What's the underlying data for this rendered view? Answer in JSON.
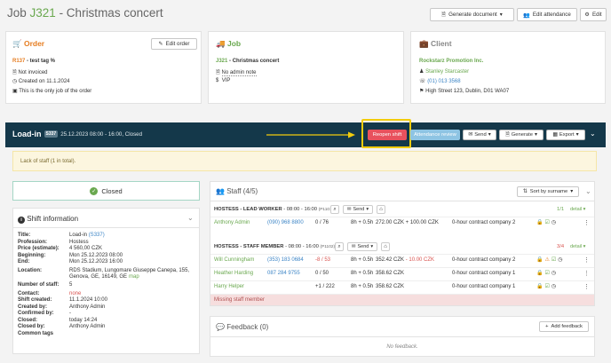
{
  "header": {
    "title_prefix": "Job ",
    "job_number": "J321",
    "title_suffix": " - Christmas concert",
    "generate_label": "Generate document",
    "edit_attendance_label": "Edit attendance",
    "edit_label": "Edit"
  },
  "order": {
    "heading": "Order",
    "edit_label": "Edit order",
    "code": "R137",
    "name": " - test tag %",
    "invoiced": "Not invoiced",
    "created": "Created on 11.1.2024",
    "only_job": "This is the only job of the order"
  },
  "job": {
    "heading": "Job",
    "code": "J321",
    "name": " - Christmas concert",
    "admin_note": "No admin note",
    "tag": "VIP"
  },
  "client": {
    "heading": "Client",
    "company": "Rockstarz Promotion Inc.",
    "contact": "Stanley Starcaster",
    "phone": "(01) 013 3568",
    "address": "High Street 123, Dublin, D01 WA07"
  },
  "shift_bar": {
    "title": "Load-in",
    "badge": "S337",
    "info": "25.12.2023 08:00 - 16:00, Closed",
    "reopen_label": "Reopen shift",
    "attendance_review_label": "Attendance review",
    "send_label": "Send",
    "generate_label": "Generate",
    "export_label": "Export"
  },
  "alert": "Lack of staff (1 in total).",
  "status": {
    "closed_label": "Closed"
  },
  "shift_info": {
    "heading": "Shift information",
    "rows": [
      {
        "label": "Title:",
        "value": "Load-in ",
        "extra": "(S337)"
      },
      {
        "label": "Profession:",
        "value": "Hostess"
      },
      {
        "label": "Price (estimate):",
        "value": "4 560,00 CZK"
      },
      {
        "label": "Beginning:",
        "value": "Mon 25.12.2023 08:00"
      },
      {
        "label": "End:",
        "value": "Mon 25.12.2023 16:00"
      },
      {
        "label": "Location:",
        "value": "RDS Stadium, Lungomare Giuseppe Canepa, 155,",
        "value2": "Genova, GE, 16149, GE",
        "extra": "map"
      },
      {
        "label": "Number of staff:",
        "value": "5"
      },
      {
        "label": "Contact:",
        "value": "none"
      },
      {
        "label": "Shift created:",
        "value": "11.1.2024 10:00"
      },
      {
        "label": "Created by:",
        "value": "Anthony Admin"
      },
      {
        "label": "Confirmed by:",
        "value": "-"
      },
      {
        "label": "Closed:",
        "value": "today 14:24"
      },
      {
        "label": "Closed by:",
        "value": "Anthony Admin"
      },
      {
        "label": "Common tags",
        "value": ""
      }
    ]
  },
  "staff": {
    "heading": "Staff (4/5)",
    "sort_label": "Sort by surname",
    "send_label": "Send",
    "detail_label": "detail",
    "lead": {
      "title": "HOSTESS - LEAD WORKER",
      "time": " - 08:00 - 16:00 ",
      "code": "(P1101)",
      "count": "1/1",
      "rows": [
        {
          "name": "Anthony Admin",
          "phone": "(090) 968 8800",
          "shifts": "0 / 76",
          "hours": "8h + 0.5h",
          "money": "272.00 CZK + 100.00 CZK",
          "money_extra": "",
          "contract": "0-hour contract company 2"
        }
      ]
    },
    "member": {
      "title": "HOSTESS - STAFF MEMBER",
      "time": " - 08:00 - 16:00 ",
      "code": "(P1102)",
      "count": "3/4",
      "rows": [
        {
          "name": "Will Cunningham",
          "phone": "(353) 183 0684",
          "shifts": "-8 / 53",
          "hours": "8h + 0.5h",
          "money": "352.42 CZK",
          "money_extra": " - 10.00 CZK",
          "contract": "0-hour contract company 2"
        },
        {
          "name": "Heather Harding",
          "phone": "087 284 9755",
          "shifts": "0 / 50",
          "hours": "8h + 0.5h",
          "money": "358.62 CZK",
          "money_extra": "",
          "contract": "0-hour contract company 1"
        },
        {
          "name": "Harry Helper",
          "phone": "",
          "shifts": "+1 / 222",
          "hours": "8h + 0.5h",
          "money": "358.62 CZK",
          "money_extra": "",
          "contract": "0-hour contract company 1"
        }
      ],
      "missing": "Missing staff member"
    }
  },
  "feedback": {
    "heading": "Feedback (0)",
    "add_label": "Add feedback",
    "empty": "No feedback."
  },
  "colors": {
    "shift_bar": "#14384a",
    "reopen": "#e8515d",
    "attendance": "#8ec4e3",
    "highlight": "#f2cc0d",
    "link_green": "#6aa84f",
    "order_orange": "#e67e22"
  }
}
